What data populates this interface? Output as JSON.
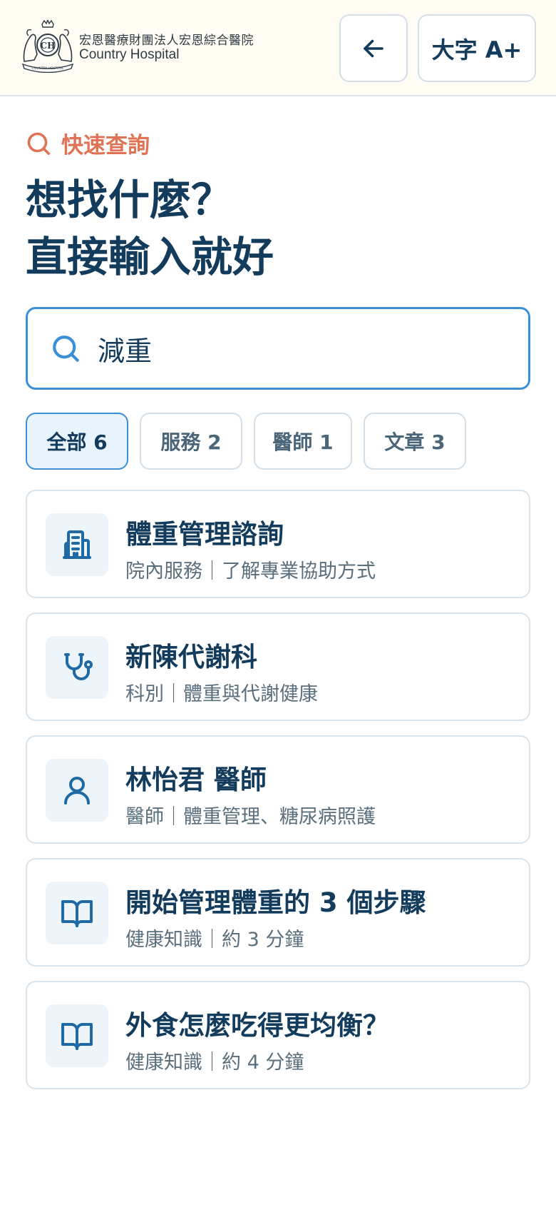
{
  "header": {
    "brand_cn": "宏恩醫療財團法人宏恩綜合醫院",
    "brand_en": "Country Hospital",
    "logo_ring_text": "COUNTRY HOSPITAL",
    "back_icon": "arrow-left-icon",
    "font_size_label": "大字 A+"
  },
  "kicker": {
    "icon": "search-icon",
    "label": "快速查詢"
  },
  "title": {
    "line1": "想找什麼？",
    "line2": "直接輸入就好"
  },
  "search": {
    "icon": "search-icon",
    "value": "減重",
    "placeholder": ""
  },
  "filters": [
    {
      "label": "全部 6",
      "active": true
    },
    {
      "label": "服務 2",
      "active": false
    },
    {
      "label": "醫師 1",
      "active": false
    },
    {
      "label": "文章 3",
      "active": false
    }
  ],
  "results": [
    {
      "icon": "building-icon",
      "title": "體重管理諮詢",
      "subtitle": "院內服務｜了解專業協助方式"
    },
    {
      "icon": "stethoscope-icon",
      "title": "新陳代謝科",
      "subtitle": "科別｜體重與代謝健康"
    },
    {
      "icon": "user-icon",
      "title": "林怡君 醫師",
      "subtitle": "醫師｜體重管理、糖尿病照護"
    },
    {
      "icon": "book-icon",
      "title": "開始管理體重的 3 個步驟",
      "subtitle": "健康知識｜約 3 分鐘"
    },
    {
      "icon": "book-icon",
      "title": "外食怎麼吃得更均衡？",
      "subtitle": "健康知識｜約 4 分鐘"
    }
  ],
  "colors": {
    "primary": "#133b5c",
    "accent": "#e07355",
    "focus_blue": "#3b8fd6",
    "header_bg": "#fffcf3",
    "icon_tile_bg": "#eef5fa",
    "chip_active_bg": "#e8f3fc"
  }
}
